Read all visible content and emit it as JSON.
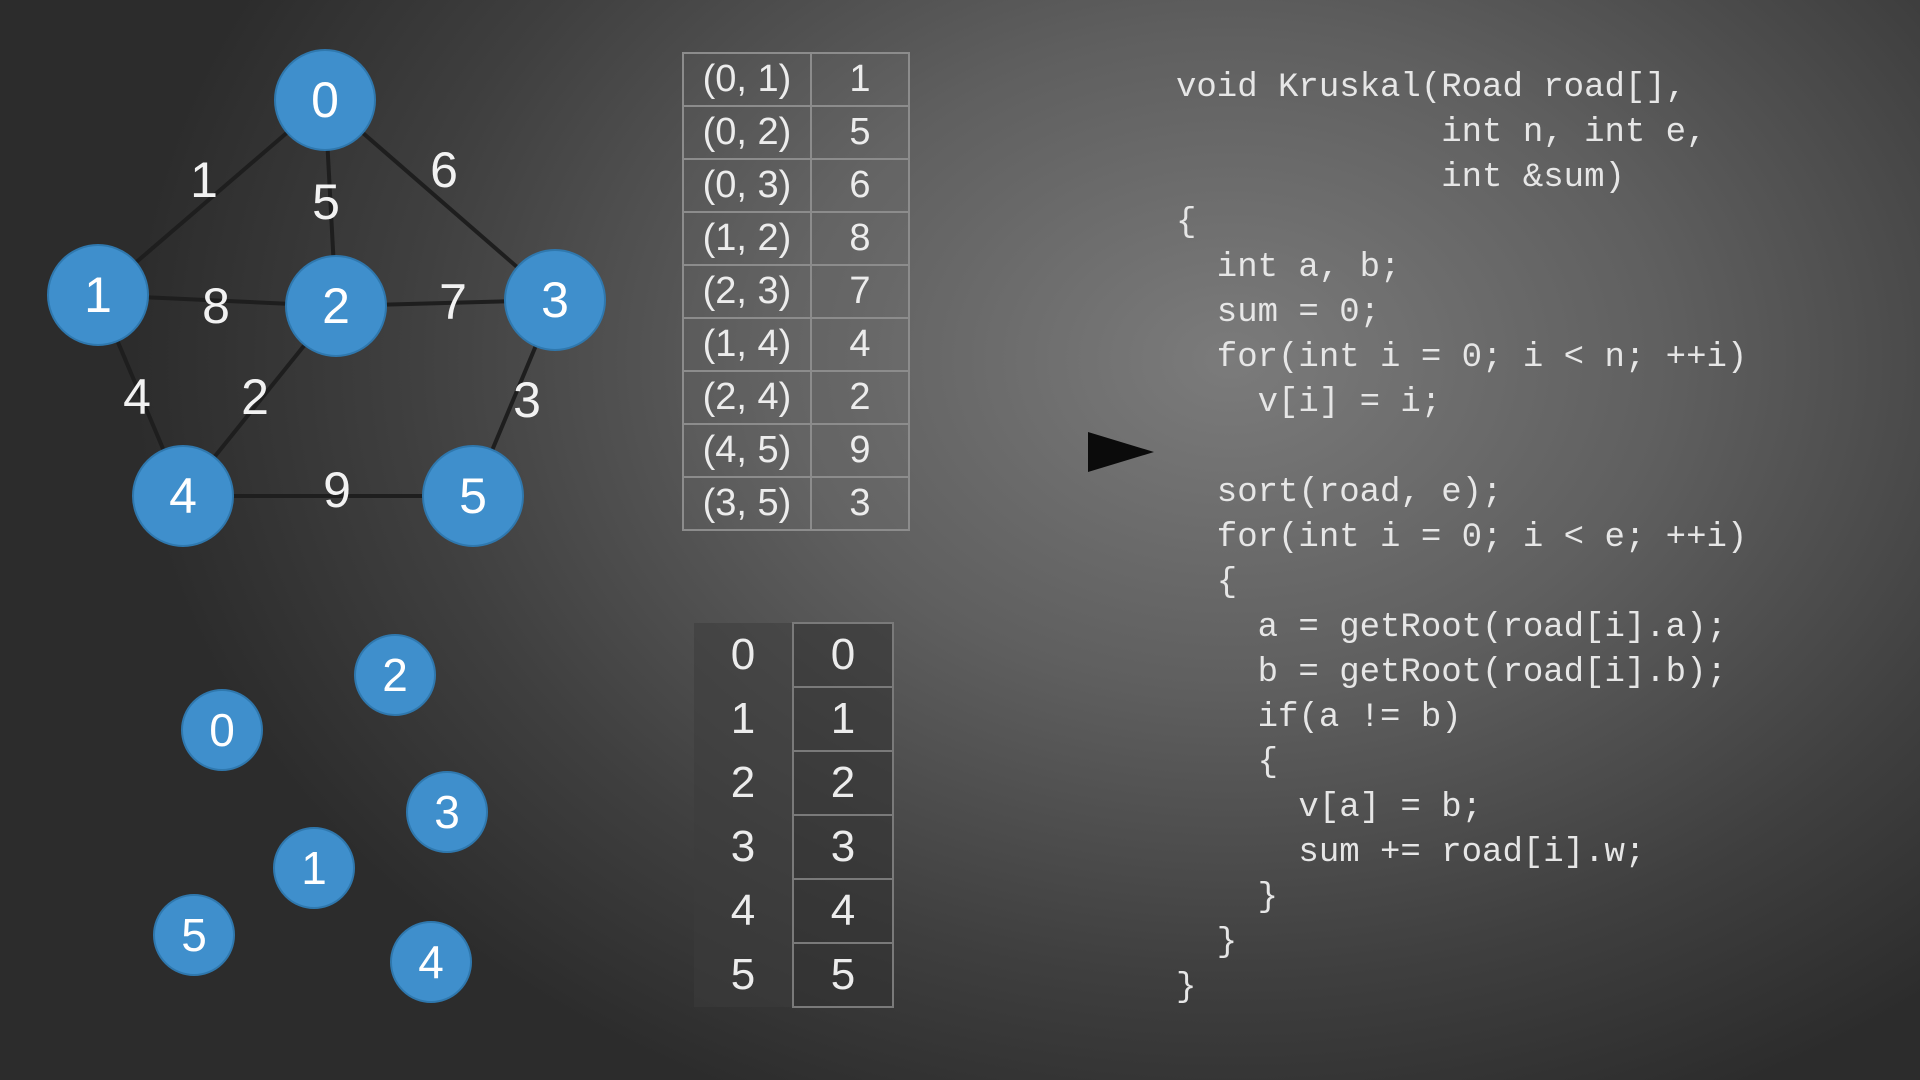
{
  "graph": {
    "nodes": [
      "0",
      "1",
      "2",
      "3",
      "4",
      "5"
    ],
    "edge_labels": [
      "1",
      "5",
      "6",
      "8",
      "7",
      "4",
      "2",
      "3",
      "9"
    ]
  },
  "edge_table": {
    "rows": [
      {
        "edge": "(0, 1)",
        "weight": "1"
      },
      {
        "edge": "(0, 2)",
        "weight": "5"
      },
      {
        "edge": "(0, 3)",
        "weight": "6"
      },
      {
        "edge": "(1, 2)",
        "weight": "8"
      },
      {
        "edge": "(2, 3)",
        "weight": "7"
      },
      {
        "edge": "(1, 4)",
        "weight": "4"
      },
      {
        "edge": "(2, 4)",
        "weight": "2"
      },
      {
        "edge": "(4, 5)",
        "weight": "9"
      },
      {
        "edge": "(3, 5)",
        "weight": "3"
      }
    ]
  },
  "disjoint_nodes": [
    "2",
    "0",
    "3",
    "1",
    "5",
    "4"
  ],
  "parent_table": {
    "rows": [
      {
        "index": "0",
        "value": "0"
      },
      {
        "index": "1",
        "value": "1"
      },
      {
        "index": "2",
        "value": "2"
      },
      {
        "index": "3",
        "value": "3"
      },
      {
        "index": "4",
        "value": "4"
      },
      {
        "index": "5",
        "value": "5"
      }
    ]
  },
  "code": "void Kruskal(Road road[],\n             int n, int e,\n             int &sum)\n{\n  int a, b;\n  sum = 0;\n  for(int i = 0; i < n; ++i)\n    v[i] = i;\n\n  sort(road, e);\n  for(int i = 0; i < e; ++i)\n  {\n    a = getRoot(road[i].a);\n    b = getRoot(road[i].b);\n    if(a != b)\n    {\n      v[a] = b;\n      sum += road[i].w;\n    }\n  }\n}",
  "colors": {
    "node": "#3f8fcc",
    "edge": "#1e1e1e",
    "arrow": "#0b0b0b"
  }
}
